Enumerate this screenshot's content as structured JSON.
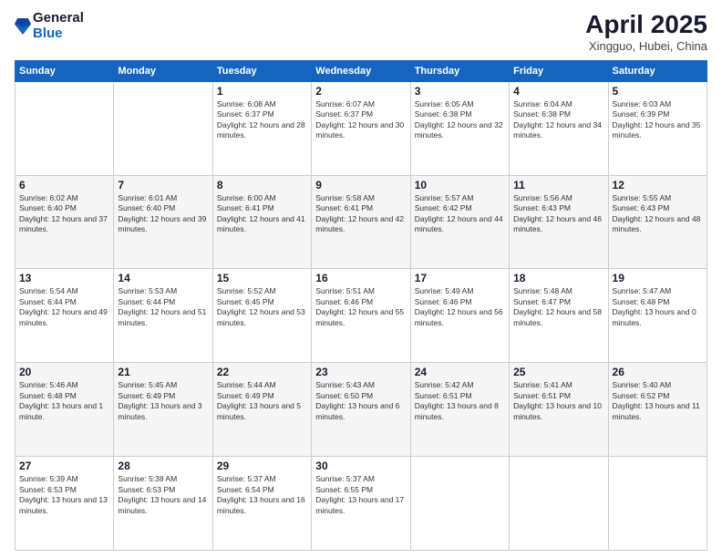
{
  "header": {
    "logo_general": "General",
    "logo_blue": "Blue",
    "month_title": "April 2025",
    "location": "Xingguo, Hubei, China"
  },
  "days_of_week": [
    "Sunday",
    "Monday",
    "Tuesday",
    "Wednesday",
    "Thursday",
    "Friday",
    "Saturday"
  ],
  "weeks": [
    [
      {
        "day": "",
        "sunrise": "",
        "sunset": "",
        "daylight": ""
      },
      {
        "day": "",
        "sunrise": "",
        "sunset": "",
        "daylight": ""
      },
      {
        "day": "1",
        "sunrise": "Sunrise: 6:08 AM",
        "sunset": "Sunset: 6:37 PM",
        "daylight": "Daylight: 12 hours and 28 minutes."
      },
      {
        "day": "2",
        "sunrise": "Sunrise: 6:07 AM",
        "sunset": "Sunset: 6:37 PM",
        "daylight": "Daylight: 12 hours and 30 minutes."
      },
      {
        "day": "3",
        "sunrise": "Sunrise: 6:05 AM",
        "sunset": "Sunset: 6:38 PM",
        "daylight": "Daylight: 12 hours and 32 minutes."
      },
      {
        "day": "4",
        "sunrise": "Sunrise: 6:04 AM",
        "sunset": "Sunset: 6:38 PM",
        "daylight": "Daylight: 12 hours and 34 minutes."
      },
      {
        "day": "5",
        "sunrise": "Sunrise: 6:03 AM",
        "sunset": "Sunset: 6:39 PM",
        "daylight": "Daylight: 12 hours and 35 minutes."
      }
    ],
    [
      {
        "day": "6",
        "sunrise": "Sunrise: 6:02 AM",
        "sunset": "Sunset: 6:40 PM",
        "daylight": "Daylight: 12 hours and 37 minutes."
      },
      {
        "day": "7",
        "sunrise": "Sunrise: 6:01 AM",
        "sunset": "Sunset: 6:40 PM",
        "daylight": "Daylight: 12 hours and 39 minutes."
      },
      {
        "day": "8",
        "sunrise": "Sunrise: 6:00 AM",
        "sunset": "Sunset: 6:41 PM",
        "daylight": "Daylight: 12 hours and 41 minutes."
      },
      {
        "day": "9",
        "sunrise": "Sunrise: 5:58 AM",
        "sunset": "Sunset: 6:41 PM",
        "daylight": "Daylight: 12 hours and 42 minutes."
      },
      {
        "day": "10",
        "sunrise": "Sunrise: 5:57 AM",
        "sunset": "Sunset: 6:42 PM",
        "daylight": "Daylight: 12 hours and 44 minutes."
      },
      {
        "day": "11",
        "sunrise": "Sunrise: 5:56 AM",
        "sunset": "Sunset: 6:43 PM",
        "daylight": "Daylight: 12 hours and 46 minutes."
      },
      {
        "day": "12",
        "sunrise": "Sunrise: 5:55 AM",
        "sunset": "Sunset: 6:43 PM",
        "daylight": "Daylight: 12 hours and 48 minutes."
      }
    ],
    [
      {
        "day": "13",
        "sunrise": "Sunrise: 5:54 AM",
        "sunset": "Sunset: 6:44 PM",
        "daylight": "Daylight: 12 hours and 49 minutes."
      },
      {
        "day": "14",
        "sunrise": "Sunrise: 5:53 AM",
        "sunset": "Sunset: 6:44 PM",
        "daylight": "Daylight: 12 hours and 51 minutes."
      },
      {
        "day": "15",
        "sunrise": "Sunrise: 5:52 AM",
        "sunset": "Sunset: 6:45 PM",
        "daylight": "Daylight: 12 hours and 53 minutes."
      },
      {
        "day": "16",
        "sunrise": "Sunrise: 5:51 AM",
        "sunset": "Sunset: 6:46 PM",
        "daylight": "Daylight: 12 hours and 55 minutes."
      },
      {
        "day": "17",
        "sunrise": "Sunrise: 5:49 AM",
        "sunset": "Sunset: 6:46 PM",
        "daylight": "Daylight: 12 hours and 56 minutes."
      },
      {
        "day": "18",
        "sunrise": "Sunrise: 5:48 AM",
        "sunset": "Sunset: 6:47 PM",
        "daylight": "Daylight: 12 hours and 58 minutes."
      },
      {
        "day": "19",
        "sunrise": "Sunrise: 5:47 AM",
        "sunset": "Sunset: 6:48 PM",
        "daylight": "Daylight: 13 hours and 0 minutes."
      }
    ],
    [
      {
        "day": "20",
        "sunrise": "Sunrise: 5:46 AM",
        "sunset": "Sunset: 6:48 PM",
        "daylight": "Daylight: 13 hours and 1 minute."
      },
      {
        "day": "21",
        "sunrise": "Sunrise: 5:45 AM",
        "sunset": "Sunset: 6:49 PM",
        "daylight": "Daylight: 13 hours and 3 minutes."
      },
      {
        "day": "22",
        "sunrise": "Sunrise: 5:44 AM",
        "sunset": "Sunset: 6:49 PM",
        "daylight": "Daylight: 13 hours and 5 minutes."
      },
      {
        "day": "23",
        "sunrise": "Sunrise: 5:43 AM",
        "sunset": "Sunset: 6:50 PM",
        "daylight": "Daylight: 13 hours and 6 minutes."
      },
      {
        "day": "24",
        "sunrise": "Sunrise: 5:42 AM",
        "sunset": "Sunset: 6:51 PM",
        "daylight": "Daylight: 13 hours and 8 minutes."
      },
      {
        "day": "25",
        "sunrise": "Sunrise: 5:41 AM",
        "sunset": "Sunset: 6:51 PM",
        "daylight": "Daylight: 13 hours and 10 minutes."
      },
      {
        "day": "26",
        "sunrise": "Sunrise: 5:40 AM",
        "sunset": "Sunset: 6:52 PM",
        "daylight": "Daylight: 13 hours and 11 minutes."
      }
    ],
    [
      {
        "day": "27",
        "sunrise": "Sunrise: 5:39 AM",
        "sunset": "Sunset: 6:53 PM",
        "daylight": "Daylight: 13 hours and 13 minutes."
      },
      {
        "day": "28",
        "sunrise": "Sunrise: 5:38 AM",
        "sunset": "Sunset: 6:53 PM",
        "daylight": "Daylight: 13 hours and 14 minutes."
      },
      {
        "day": "29",
        "sunrise": "Sunrise: 5:37 AM",
        "sunset": "Sunset: 6:54 PM",
        "daylight": "Daylight: 13 hours and 16 minutes."
      },
      {
        "day": "30",
        "sunrise": "Sunrise: 5:37 AM",
        "sunset": "Sunset: 6:55 PM",
        "daylight": "Daylight: 13 hours and 17 minutes."
      },
      {
        "day": "",
        "sunrise": "",
        "sunset": "",
        "daylight": ""
      },
      {
        "day": "",
        "sunrise": "",
        "sunset": "",
        "daylight": ""
      },
      {
        "day": "",
        "sunrise": "",
        "sunset": "",
        "daylight": ""
      }
    ]
  ]
}
